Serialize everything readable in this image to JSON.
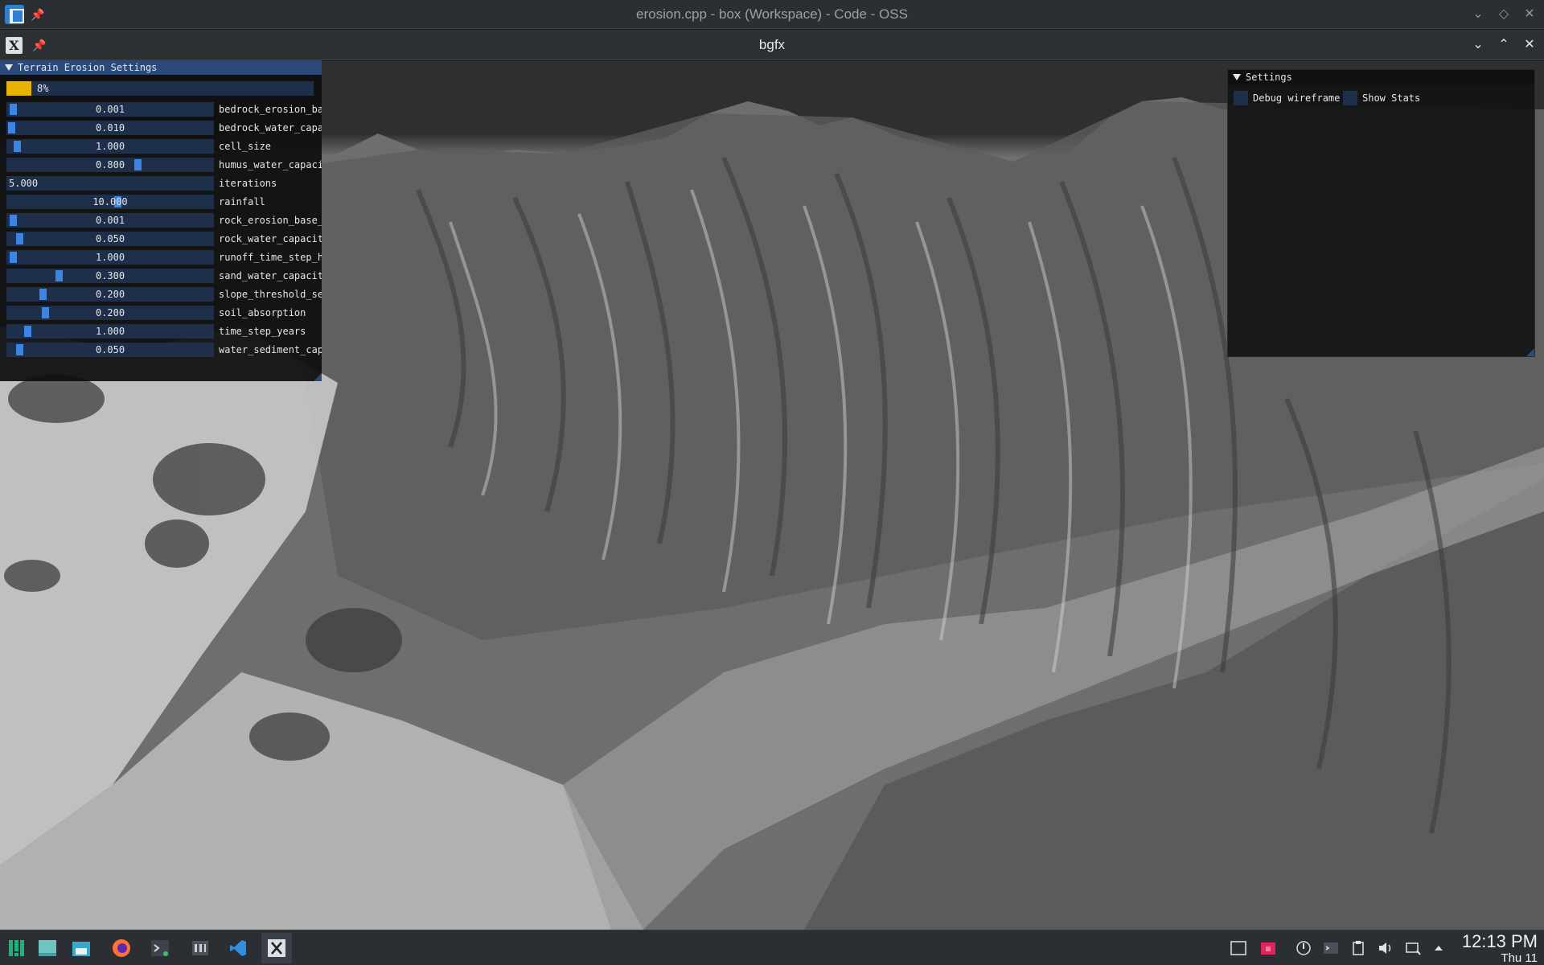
{
  "outer_window": {
    "title": "erosion.cpp - box (Workspace) - Code - OSS"
  },
  "inner_window": {
    "title": "bgfx",
    "icon_glyph": "X"
  },
  "erosion_panel": {
    "title": "Terrain Erosion Settings",
    "progress": {
      "fraction": 0.08,
      "label": "8%",
      "color": "#e6b400"
    },
    "params": [
      {
        "label": "bedrock_erosion_ba",
        "value": "0.001",
        "level": 0.01
      },
      {
        "label": "bedrock_water_capa",
        "value": "0.010",
        "level": 0.0
      },
      {
        "label": "cell_size",
        "value": "1.000",
        "level": 0.03
      },
      {
        "label": "humus_water_capaci",
        "value": "0.800",
        "level": 0.64
      },
      {
        "label": "iterations",
        "value": "5.000",
        "level": null
      },
      {
        "label": "rainfall",
        "value": "10.000",
        "level": 0.54
      },
      {
        "label": "rock_erosion_base_",
        "value": "0.001",
        "level": 0.01
      },
      {
        "label": "rock_water_capacit",
        "value": "0.050",
        "level": 0.04
      },
      {
        "label": "runoff_time_step_h",
        "value": "1.000",
        "level": 0.01
      },
      {
        "label": "sand_water_capacit",
        "value": "0.300",
        "level": 0.24
      },
      {
        "label": "slope_threshold_se",
        "value": "0.200",
        "level": 0.16
      },
      {
        "label": "soil_absorption",
        "value": "0.200",
        "level": 0.17
      },
      {
        "label": "time_step_years",
        "value": "1.000",
        "level": 0.08
      },
      {
        "label": "water_sediment_cap",
        "value": "0.050",
        "level": 0.04
      }
    ]
  },
  "settings_panel": {
    "title": "Settings",
    "checkboxes": [
      {
        "label": "Debug wireframe",
        "checked": false
      },
      {
        "label": "Show Stats",
        "checked": false
      }
    ]
  },
  "taskbar": {
    "apps": [
      "app-launcher-icon",
      "desktop-icon",
      "file-manager-icon",
      "firefox-icon",
      "terminal-icon",
      "settings-app-icon",
      "vscode-icon",
      "bgfx-app-icon"
    ],
    "active_app": "bgfx-app-icon",
    "clock": {
      "time": "12:13 PM",
      "date": "Thu 11"
    }
  },
  "colors": {
    "imgui_header": "#294a7a",
    "imgui_frame": "#1d2f4a",
    "imgui_grab": "#3d85e0",
    "taskbar": "#2b2f33"
  }
}
